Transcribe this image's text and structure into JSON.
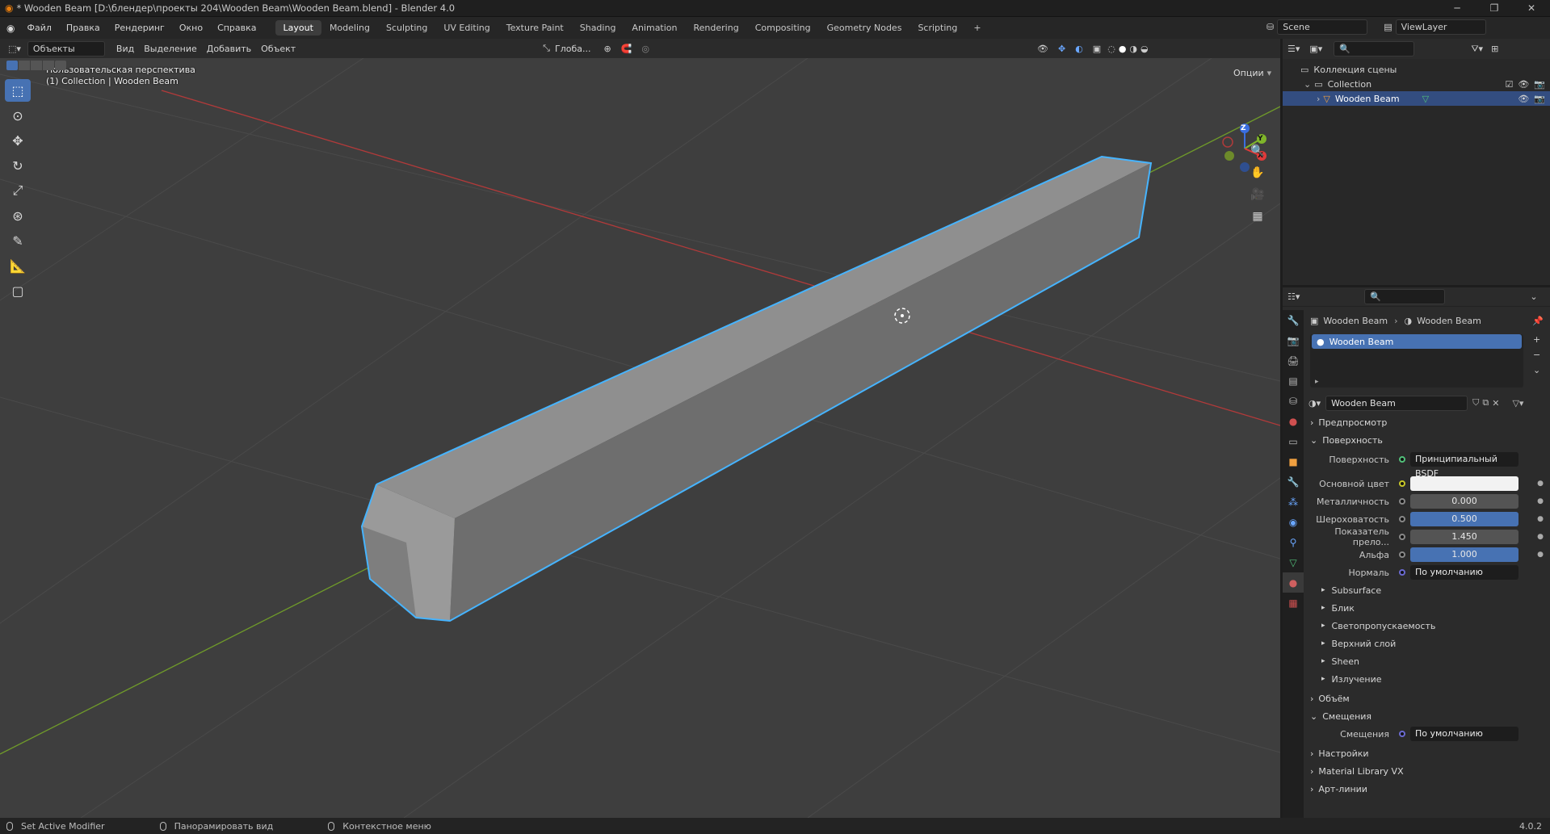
{
  "window": {
    "title": "* Wooden Beam [D:\\блендер\\проекты 204\\Wooden Beam\\Wooden Beam.blend] - Blender 4.0",
    "controls": [
      "─",
      "❐",
      "✕"
    ]
  },
  "topbar": {
    "menus": [
      "Файл",
      "Правка",
      "Рендеринг",
      "Окно",
      "Справка"
    ],
    "workspaces": [
      "Layout",
      "Modeling",
      "Sculpting",
      "UV Editing",
      "Texture Paint",
      "Shading",
      "Animation",
      "Rendering",
      "Compositing",
      "Geometry Nodes",
      "Scripting"
    ],
    "active_workspace": "Layout",
    "add_tab": "+",
    "scene": "Scene",
    "view_layer": "ViewLayer"
  },
  "viewport_header": {
    "mode": "Объекты",
    "menus": [
      "Вид",
      "Выделение",
      "Добавить",
      "Объект"
    ],
    "orientation": "Глоба...",
    "options": "Опции"
  },
  "viewport": {
    "perspective_label": "Пользовательская перспектива",
    "collection_label": "(1) Collection | Wooden Beam",
    "gizmo_axes": [
      "Z",
      "Y",
      "X"
    ],
    "colors": {
      "background": "#3e3e3e",
      "grid": "#4a4a4a",
      "axis_x": "#b23a3a",
      "axis_y": "#6f9a2a",
      "beam_top": "#8f8f8f",
      "beam_side": "#6e6e6e",
      "beam_end": "#9a9a9a",
      "selection_outline": "#46b4ff"
    }
  },
  "outliner": {
    "scene_collection": "Коллекция сцены",
    "collection": "Collection",
    "object": "Wooden Beam"
  },
  "properties": {
    "breadcrumb_object": "Wooden Beam",
    "breadcrumb_material": "Wooden Beam",
    "material_slot": "Wooden Beam",
    "material_name": "Wooden Beam",
    "sections": {
      "preview": "Предпросмотр",
      "surface": "Поверхность",
      "volume": "Объём",
      "displacement": "Смещения",
      "settings": "Настройки",
      "material_library": "Material Library VX",
      "line_art": "Арт-линии"
    },
    "surface": {
      "label": "Поверхность",
      "value": "Принципиальный BSDF"
    },
    "fields": [
      {
        "label": "Основной цвет",
        "value": "",
        "type": "color"
      },
      {
        "label": "Металличность",
        "value": "0.000",
        "type": "number"
      },
      {
        "label": "Шероховатость",
        "value": "0.500",
        "type": "slider",
        "fill": 0.5
      },
      {
        "label": "Показатель прело...",
        "value": "1.450",
        "type": "number"
      },
      {
        "label": "Альфа",
        "value": "1.000",
        "type": "slider",
        "fill": 1.0
      },
      {
        "label": "Нормаль",
        "value": "По умолчанию",
        "type": "link"
      }
    ],
    "subpanels": [
      "Subsurface",
      "Блик",
      "Светопропускаемость",
      "Верхний слой",
      "Sheen",
      "Излучение"
    ],
    "displacement": {
      "label": "Смещения",
      "value": "По умолчанию"
    }
  },
  "statusbar": {
    "items": [
      "Set Active Modifier",
      "Панорамировать вид",
      "Контекстное меню"
    ],
    "version": "4.0.2"
  }
}
